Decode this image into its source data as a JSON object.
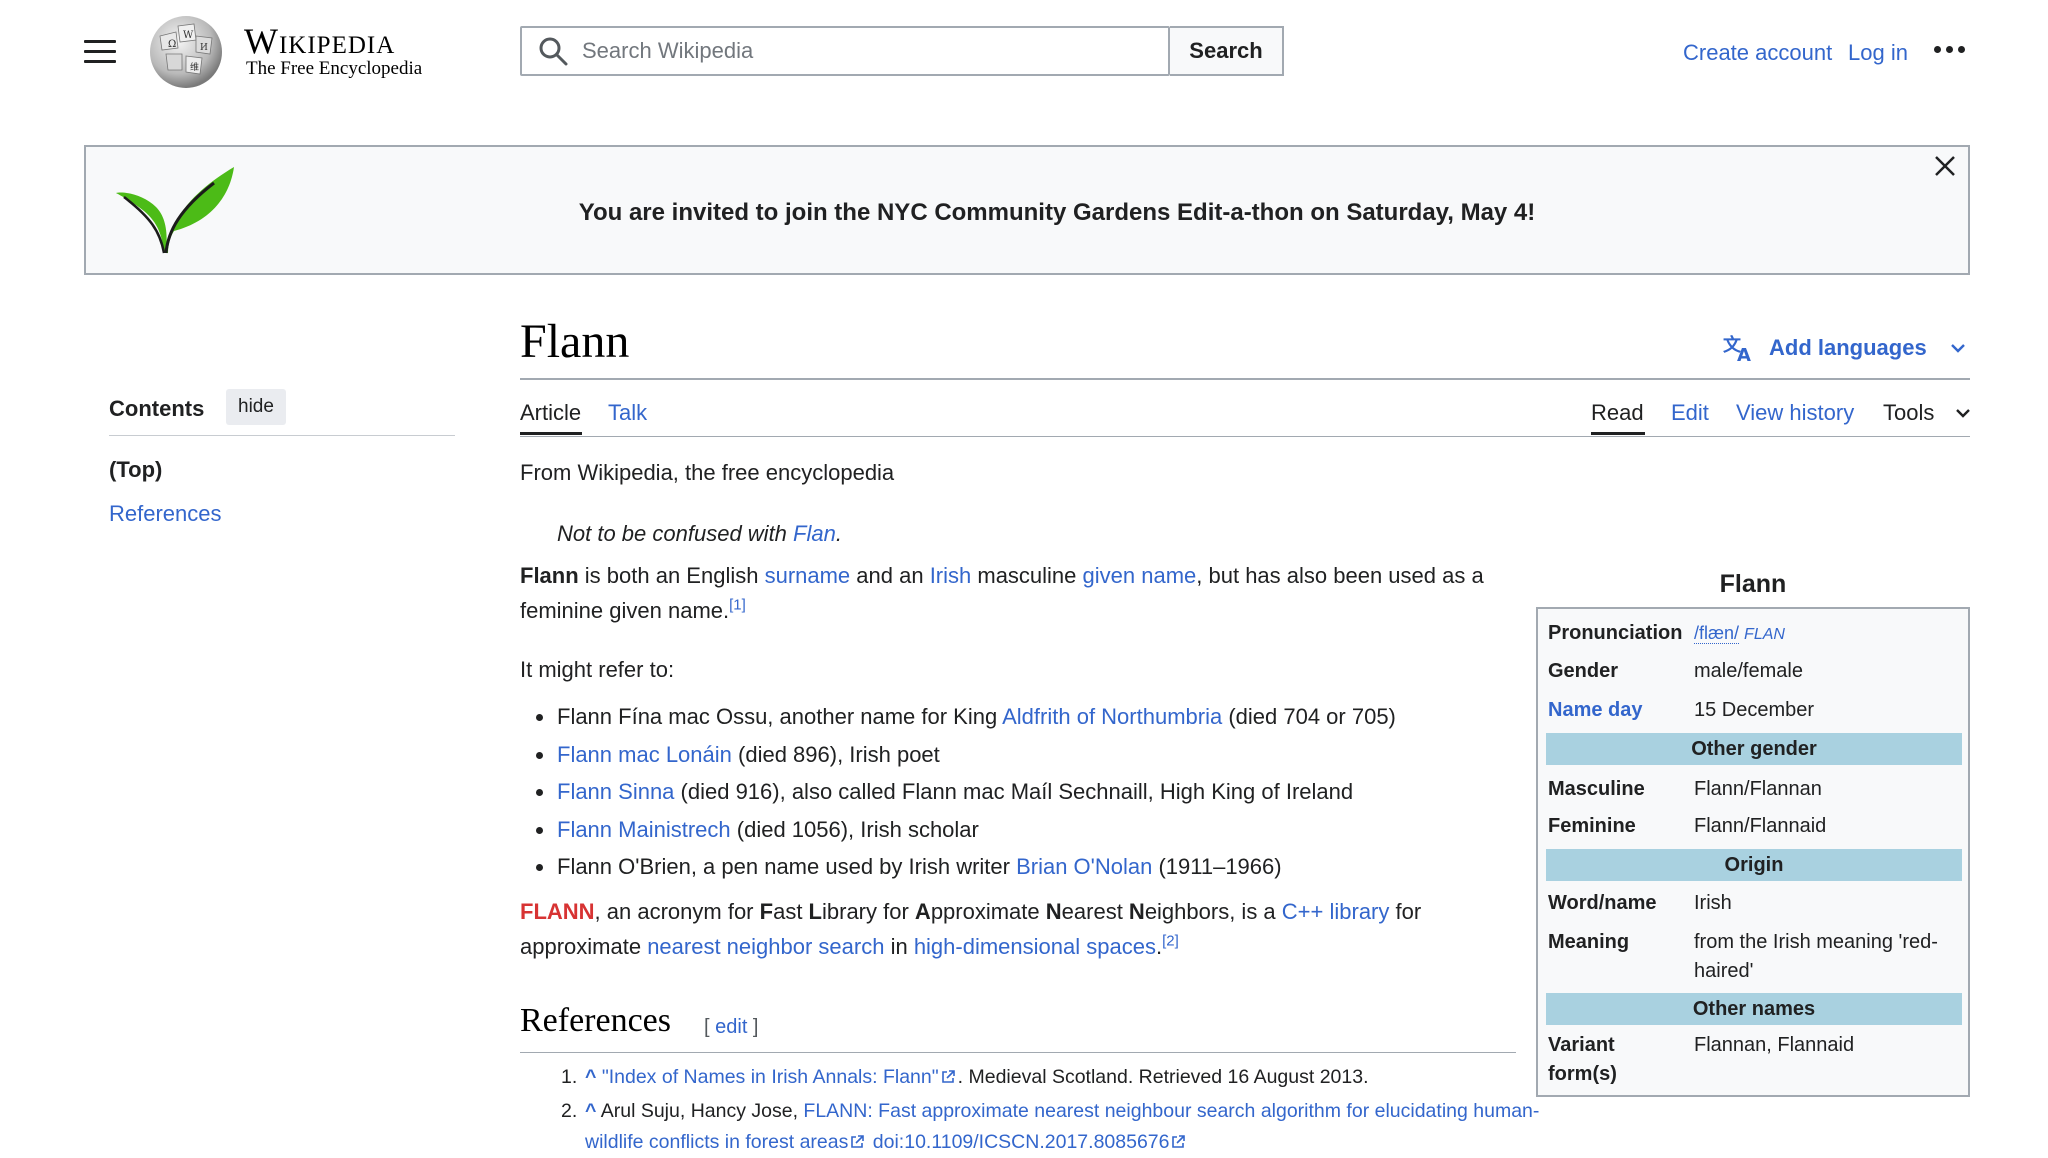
{
  "header": {
    "wordmark": "Wikipedia",
    "tagline": "The Free Encyclopedia",
    "search_placeholder": "Search Wikipedia",
    "search_button": "Search",
    "create_account": "Create account",
    "login": "Log in"
  },
  "banner": {
    "text": "You are invited to join the NYC Community Gardens Edit-a-thon on Saturday, May 4!"
  },
  "toc": {
    "title": "Contents",
    "hide": "hide",
    "items": [
      "(Top)",
      "References"
    ]
  },
  "page": {
    "title": "Flann",
    "add_languages": "Add languages",
    "tabs_left": [
      "Article",
      "Talk"
    ],
    "tabs_right": [
      "Read",
      "Edit",
      "View history",
      "Tools"
    ]
  },
  "article": {
    "from_wiki": "From Wikipedia, the free encyclopedia",
    "hatnote_prefix": "Not to be confused with ",
    "hatnote_link": "Flan",
    "hatnote_suffix": ".",
    "lead": {
      "bold": "Flann",
      "t1": " is both an English ",
      "l1": "surname",
      "t2": " and an ",
      "l2": "Irish",
      "t3": " masculine ",
      "l3": "given name",
      "t4": ", but has also been used as a feminine given name.",
      "ref": "[1]"
    },
    "might_refer": "It might refer to:",
    "bullets": [
      {
        "pre": "Flann Fína mac Ossu, another name for King ",
        "link": "Aldfrith of Northumbria",
        "post": " (died 704 or 705)"
      },
      {
        "pre": "",
        "link": "Flann mac Lonáin",
        "post": " (died 896), Irish poet"
      },
      {
        "pre": "",
        "link": "Flann Sinna",
        "post": " (died 916), also called Flann mac Maíl Sechnaill, High King of Ireland"
      },
      {
        "pre": "",
        "link": "Flann Mainistrech",
        "post": " (died 1056), Irish scholar"
      },
      {
        "pre": "Flann O'Brien, a pen name used by Irish writer ",
        "link": "Brian O'Nolan",
        "post": " (1911–1966)"
      }
    ],
    "acronym": {
      "red_link": "FLANN",
      "t1": ", an acronym for ",
      "F": "F",
      "ast": "ast ",
      "L": "L",
      "ibrary": "ibrary for ",
      "A": "A",
      "pproximate": "pproximate ",
      "N1": "N",
      "earest": "earest ",
      "N2": "N",
      "eighbors": "eighbors, is a ",
      "l1": "C++ library",
      "t2": " for approximate ",
      "l2": "nearest neighbor search",
      "t3": " in ",
      "l3": "high-dimensional spaces",
      "t4": ".",
      "ref": "[2]"
    },
    "references_heading": "References",
    "references_edit": "edit",
    "references": [
      {
        "num": "1.",
        "caret": "^",
        "link": "\"Index of Names in Irish Annals: Flann\"",
        "rest": ". Medieval Scotland. Retrieved 16 August 2013."
      },
      {
        "num": "2.",
        "caret": "^",
        "pre": "Arul Suju, Hancy Jose, ",
        "link": "FLANN: Fast approximate nearest neighbour search algorithm for elucidating human-wildlife conflicts in forest areas",
        "doi": "doi:10.1109/ICSCN.2017.8085676"
      }
    ]
  },
  "infobox": {
    "title": "Flann",
    "pronunciation_label": "Pronunciation",
    "pronunciation_ipa": "/flæn/",
    "pronunciation_resp": "FLAN",
    "gender_label": "Gender",
    "gender_value": "male/female",
    "nameday_label": "Name day",
    "nameday_value": "15 December",
    "header_other_gender": "Other gender",
    "masculine_label": "Masculine",
    "masculine_value": "Flann/Flannan",
    "feminine_label": "Feminine",
    "feminine_value": "Flann/Flannaid",
    "header_origin": "Origin",
    "word_label": "Word/name",
    "word_value": "Irish",
    "meaning_label": "Meaning",
    "meaning_value": "from the Irish meaning 'red-haired'",
    "header_other_names": "Other names",
    "variant_label": "Variant form(s)",
    "variant_value": "Flannan, Flannaid"
  },
  "colors": {
    "link": "#3366cc",
    "red_link": "#d73333",
    "infobox_header": "#a9d1e0",
    "leaf_green": "#4cbb17"
  }
}
